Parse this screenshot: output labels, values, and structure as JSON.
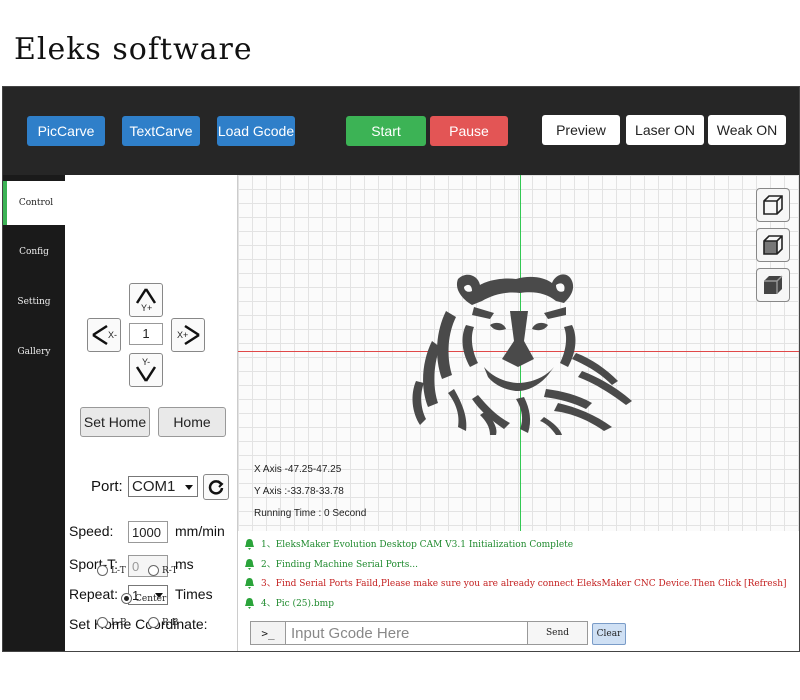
{
  "page_title": "Eleks software",
  "toolbar": {
    "piccarve": "PicCarve",
    "textcarve": "TextCarve",
    "load_gcode": "Load Gcode",
    "start": "Start",
    "pause": "Pause",
    "preview": "Preview",
    "laser_on": "Laser ON",
    "weak_on": "Weak ON"
  },
  "sidebar": {
    "tabs": [
      {
        "label": "Control",
        "active": true
      },
      {
        "label": "Config",
        "active": false
      },
      {
        "label": "Setting",
        "active": false
      },
      {
        "label": "Gallery",
        "active": false
      }
    ]
  },
  "control": {
    "jog": {
      "up": "Y+",
      "down": "Y-",
      "left": "X-",
      "right": "X+",
      "step": "1"
    },
    "set_home": "Set Home",
    "home": "Home",
    "port_label": "Port:",
    "port_value": "COM1",
    "speed_label": "Speed:",
    "speed_value": "1000",
    "speed_unit": "mm/min",
    "sport_label": "Sport-T:",
    "sport_value": "0",
    "sport_unit": "ms",
    "repeat_label": "Repeat:",
    "repeat_value": "1",
    "repeat_unit": "Times",
    "home_coord_label": "Set Home Coordinate:",
    "home_options": {
      "lt": "L-T",
      "rt": "R-T",
      "center": "Center",
      "lb": "L-B",
      "rb": "R-B"
    },
    "home_selected": "Center"
  },
  "canvas": {
    "x_axis": "X Axis -47.25-47.25",
    "y_axis": "Y Axis :-33.78-33.78",
    "running_time": "Running Time : 0 Second"
  },
  "console": {
    "log": [
      {
        "text": "1、EleksMaker Evolution Desktop CAM V3.1 Initialization Complete",
        "status": "ok"
      },
      {
        "text": "2、Finding Machine Serial Ports...",
        "status": "ok"
      },
      {
        "text": "3、Find Serial Ports Faild,Please make sure you are already connect EleksMaker CNC Device.Then Click [Refresh]",
        "status": "error"
      },
      {
        "text": "4、Pic (25).bmp",
        "status": "ok"
      }
    ],
    "prompt": ">_",
    "gcode_placeholder": "Input Gcode Here",
    "send": "Send",
    "clear": "Clear"
  },
  "colors": {
    "toolbar_bg": "#262626",
    "blue": "#2f7fc9",
    "green": "#3cb355",
    "red": "#e35555",
    "sidebar_bg": "#1a1a1a",
    "axis_x": "#e04848",
    "axis_y": "#32c853"
  },
  "icons": [
    "arrow-up-icon",
    "arrow-down-icon",
    "arrow-left-icon",
    "arrow-right-icon",
    "refresh-icon",
    "cube-wireframe-icon",
    "cube-shaded-icon",
    "cube-solid-icon",
    "bell-icon",
    "tiger-image"
  ]
}
